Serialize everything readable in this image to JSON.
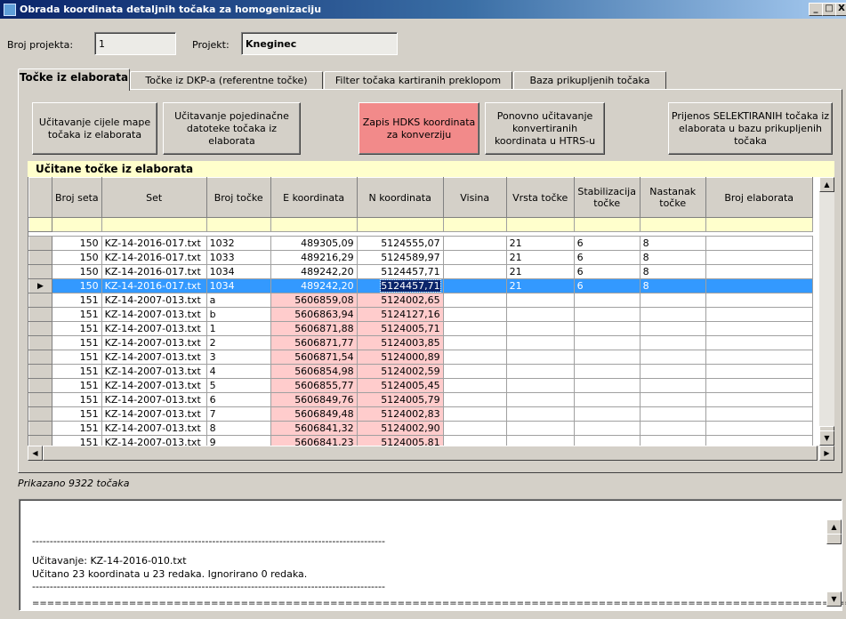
{
  "window": {
    "title": "Obrada koordinata detaljnih točaka za homogenizaciju",
    "min_label": "_",
    "max_label": "□",
    "close_label": "X"
  },
  "header": {
    "broj_projekta_label": "Broj projekta:",
    "broj_projekta_value": "1",
    "projekt_label": "Projekt:",
    "projekt_value": "Kneginec"
  },
  "tabs": [
    {
      "label": "Točke iz elaborata"
    },
    {
      "label": "Točke iz DKP-a (referentne točke)"
    },
    {
      "label": "Filter točaka kartiranih preklopom"
    },
    {
      "label": "Baza prikupljenih točaka"
    }
  ],
  "buttons": {
    "ucitavanje_mape": "Učitavanje cijele mape točaka iz elaborata",
    "ucitavanje_datoteke": "Učitavanje pojedinačne datoteke točaka iz elaborata",
    "zapis_hdks": "Zapis HDKS koordinata za konverziju",
    "ponovno_ucitavanje": "Ponovno učitavanje konvertiranih koordinata u HTRS-u",
    "prijenos": "Prijenos SELEKTIRANIH točaka iz elaborata u bazu prikupljenih točaka"
  },
  "grid": {
    "caption": "Učitane točke iz elaborata",
    "columns": [
      "Broj seta",
      "Set",
      "Broj točke",
      "E koordinata",
      "N koordinata",
      "Visina",
      "Vrsta točke",
      "Stabilizacija točke",
      "Nastanak točke",
      "Broj elaborata"
    ],
    "rows": [
      {
        "broj_seta": "150",
        "set": "KZ-14-2016-017.txt",
        "broj_tocke": "1032",
        "e": "489305,09",
        "n": "5124555,07",
        "visina": "",
        "vrsta": "21",
        "stab": "6",
        "nastanak": "8",
        "elaborat": ""
      },
      {
        "broj_seta": "150",
        "set": "KZ-14-2016-017.txt",
        "broj_tocke": "1033",
        "e": "489216,29",
        "n": "5124589,97",
        "visina": "",
        "vrsta": "21",
        "stab": "6",
        "nastanak": "8",
        "elaborat": ""
      },
      {
        "broj_seta": "150",
        "set": "KZ-14-2016-017.txt",
        "broj_tocke": "1034",
        "e": "489242,20",
        "n": "5124457,71",
        "visina": "",
        "vrsta": "21",
        "stab": "6",
        "nastanak": "8",
        "elaborat": ""
      },
      {
        "broj_seta": "150",
        "set": "KZ-14-2016-017.txt",
        "broj_tocke": "1034",
        "e": "489242,20",
        "n": "5124457,71",
        "visina": "",
        "vrsta": "21",
        "stab": "6",
        "nastanak": "8",
        "elaborat": ""
      },
      {
        "broj_seta": "151",
        "set": "KZ-14-2007-013.txt",
        "broj_tocke": "a",
        "e": "5606859,08",
        "n": "5124002,65",
        "visina": "",
        "vrsta": "",
        "stab": "",
        "nastanak": "",
        "elaborat": ""
      },
      {
        "broj_seta": "151",
        "set": "KZ-14-2007-013.txt",
        "broj_tocke": "b",
        "e": "5606863,94",
        "n": "5124127,16",
        "visina": "",
        "vrsta": "",
        "stab": "",
        "nastanak": "",
        "elaborat": ""
      },
      {
        "broj_seta": "151",
        "set": "KZ-14-2007-013.txt",
        "broj_tocke": "1",
        "e": "5606871,88",
        "n": "5124005,71",
        "visina": "",
        "vrsta": "",
        "stab": "",
        "nastanak": "",
        "elaborat": ""
      },
      {
        "broj_seta": "151",
        "set": "KZ-14-2007-013.txt",
        "broj_tocke": "2",
        "e": "5606871,77",
        "n": "5124003,85",
        "visina": "",
        "vrsta": "",
        "stab": "",
        "nastanak": "",
        "elaborat": ""
      },
      {
        "broj_seta": "151",
        "set": "KZ-14-2007-013.txt",
        "broj_tocke": "3",
        "e": "5606871,54",
        "n": "5124000,89",
        "visina": "",
        "vrsta": "",
        "stab": "",
        "nastanak": "",
        "elaborat": ""
      },
      {
        "broj_seta": "151",
        "set": "KZ-14-2007-013.txt",
        "broj_tocke": "4",
        "e": "5606854,98",
        "n": "5124002,59",
        "visina": "",
        "vrsta": "",
        "stab": "",
        "nastanak": "",
        "elaborat": ""
      },
      {
        "broj_seta": "151",
        "set": "KZ-14-2007-013.txt",
        "broj_tocke": "5",
        "e": "5606855,77",
        "n": "5124005,45",
        "visina": "",
        "vrsta": "",
        "stab": "",
        "nastanak": "",
        "elaborat": ""
      },
      {
        "broj_seta": "151",
        "set": "KZ-14-2007-013.txt",
        "broj_tocke": "6",
        "e": "5606849,76",
        "n": "5124005,79",
        "visina": "",
        "vrsta": "",
        "stab": "",
        "nastanak": "",
        "elaborat": ""
      },
      {
        "broj_seta": "151",
        "set": "KZ-14-2007-013.txt",
        "broj_tocke": "7",
        "e": "5606849,48",
        "n": "5124002,83",
        "visina": "",
        "vrsta": "",
        "stab": "",
        "nastanak": "",
        "elaborat": ""
      },
      {
        "broj_seta": "151",
        "set": "KZ-14-2007-013.txt",
        "broj_tocke": "8",
        "e": "5606841,32",
        "n": "5124002,90",
        "visina": "",
        "vrsta": "",
        "stab": "",
        "nastanak": "",
        "elaborat": ""
      },
      {
        "broj_seta": "151",
        "set": "KZ-14-2007-013.txt",
        "broj_tocke": "9",
        "e": "5606841,23",
        "n": "5124005,81",
        "visina": "",
        "vrsta": "",
        "stab": "",
        "nastanak": "",
        "elaborat": ""
      }
    ],
    "selected_row": 3,
    "row_indicator": "▶"
  },
  "status": {
    "count_text": "Prikazano 9322 točaka"
  },
  "console": {
    "lines": [
      "----------------------------------------------------------------------------------------------------",
      "Učitavanje:  KZ-14-2016-010.txt",
      "Učitano 23 koordinata u 23 redaka. Ignorirano 0 redaka.",
      "----------------------------------------------------------------------------------------------------",
      "==============================================================================================================="
    ]
  },
  "icons": {
    "scroll_up": "scroll-up-icon",
    "scroll_down": "scroll-down-icon",
    "scroll_left": "scroll-left-icon",
    "scroll_right": "scroll-right-icon",
    "app": "app-icon"
  },
  "colors": {
    "pink_cell": "#ffcccc",
    "selection": "#3399ff",
    "caption_bg": "#ffffcc",
    "red_button": "#f28a8a"
  }
}
